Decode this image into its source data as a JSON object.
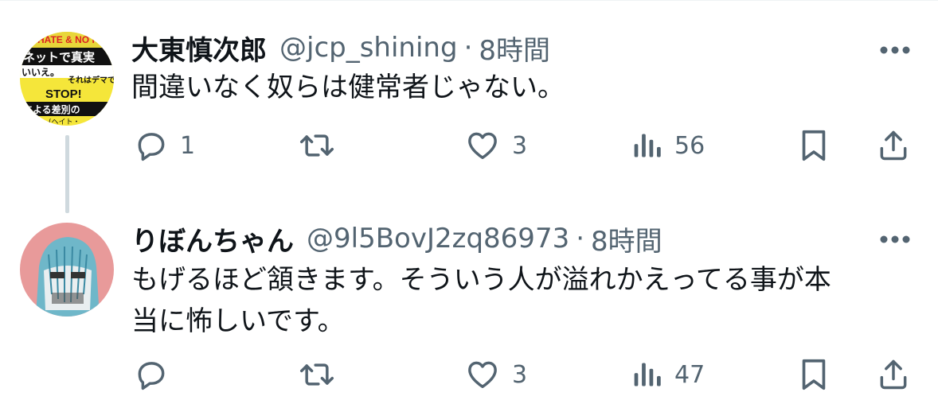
{
  "tweets": [
    {
      "display_name": "大東慎次郎",
      "handle": "@jcp_shining",
      "separator": "·",
      "time": "8時間",
      "text": "間違いなく奴らは健常者じゃない。",
      "avatar_text": [
        "HATE & NO RA",
        "ネットで真実",
        "いいえ。",
        "それはデマで",
        "STOP!",
        "による差別の",
        "(ヘイト・"
      ],
      "replies": "1",
      "retweets": "",
      "likes": "3",
      "views": "56"
    },
    {
      "display_name": "りぼんちゃん",
      "handle": "@9l5BovJ2zq86973",
      "separator": "·",
      "time": "8時間",
      "text_lines": [
        "もげるほど頷きます。そういう人が溢れかえってる事が本",
        "当に怖しいです。"
      ],
      "replies": "",
      "retweets": "",
      "likes": "3",
      "views": "47"
    }
  ],
  "colors": {
    "text_primary": "#0f1419",
    "text_secondary": "#536471",
    "thread_line": "#cfd9de",
    "divider": "#eff3f4"
  },
  "icons": [
    "reply-icon",
    "retweet-icon",
    "like-icon",
    "views-icon",
    "bookmark-icon",
    "share-icon",
    "more-icon"
  ]
}
